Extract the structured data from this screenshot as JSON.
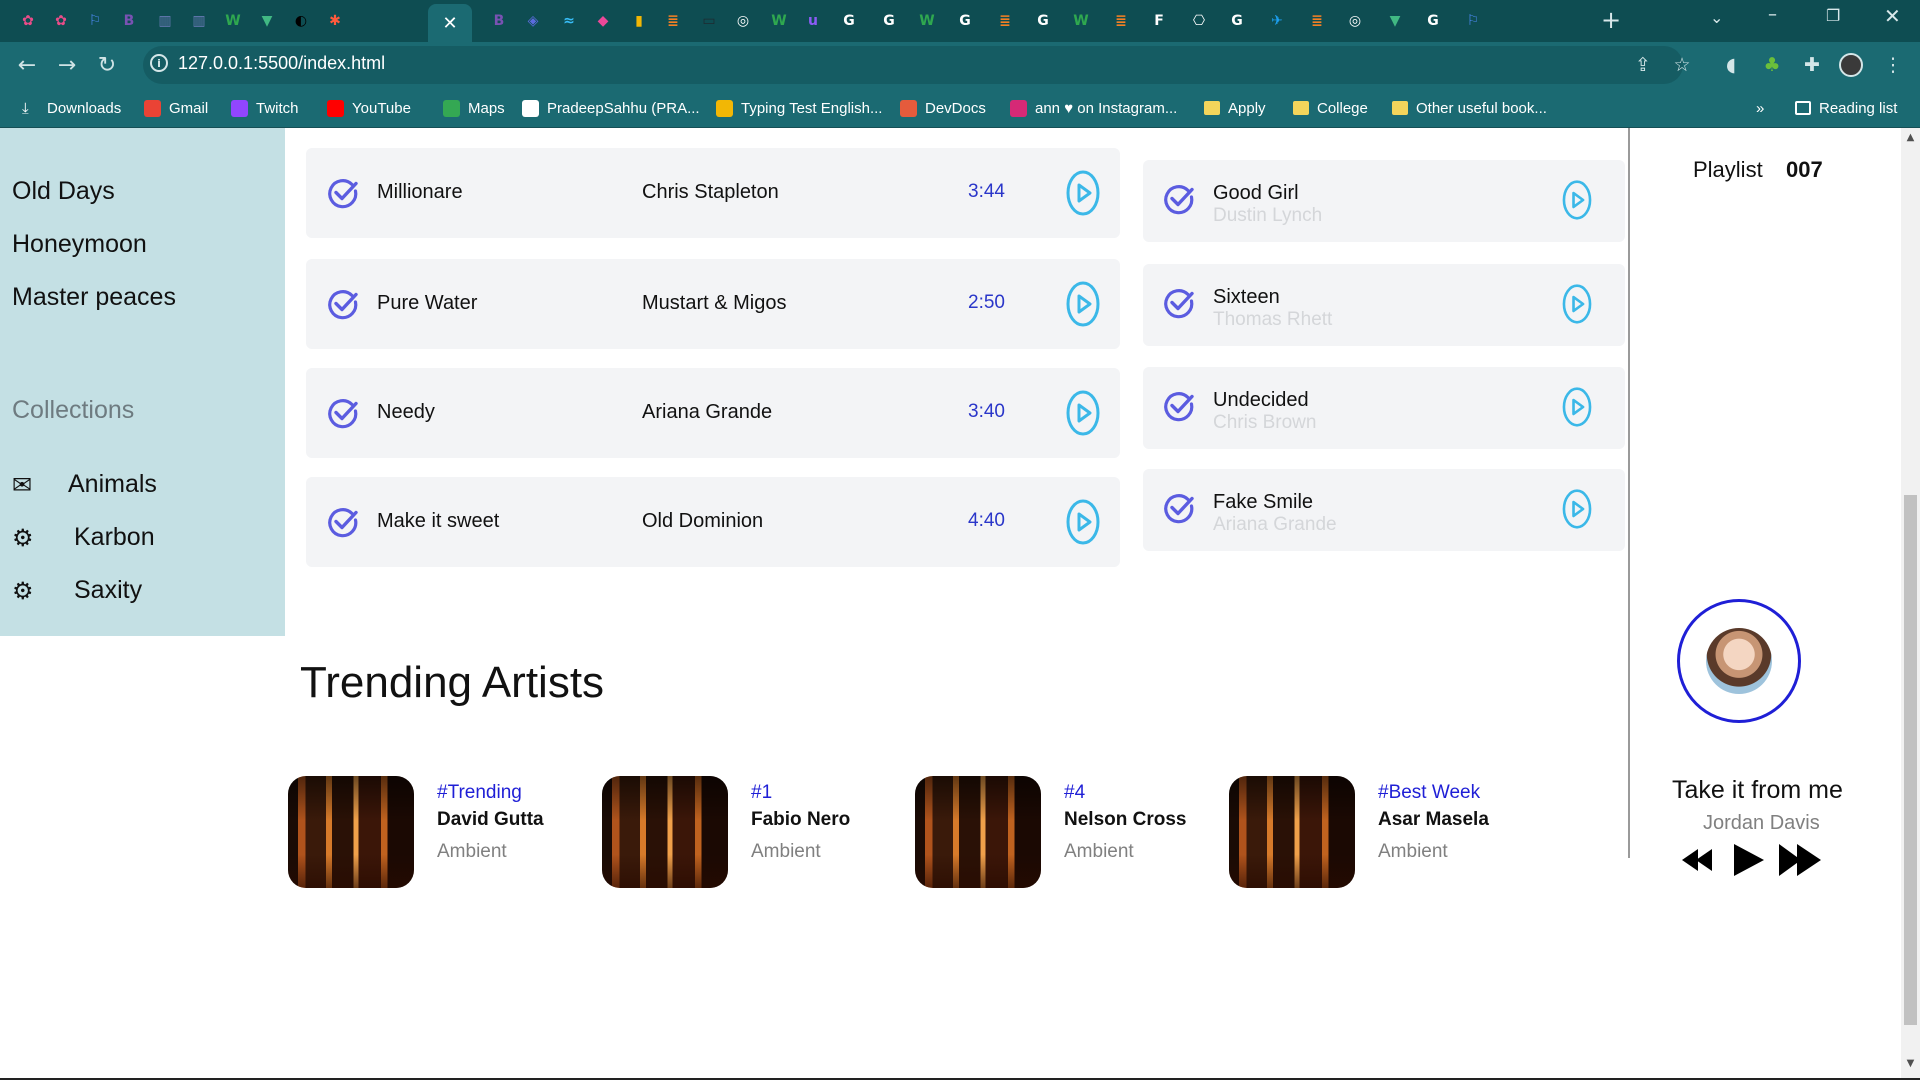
{
  "browser": {
    "tabs": [
      {
        "name": "dribbble-tab-icon",
        "color": "#ea4c89",
        "glyph": "✿"
      },
      {
        "name": "dribbble-tab-icon",
        "color": "#ea4c89",
        "glyph": "✿"
      },
      {
        "name": "flag-tab-icon",
        "color": "#4c8bf5",
        "glyph": "⚐"
      },
      {
        "name": "bootstrap-tab-icon",
        "color": "#7952b3",
        "glyph": "B"
      },
      {
        "name": "uib-tab-icon",
        "color": "#6a7cb8",
        "glyph": "▥"
      },
      {
        "name": "uib-tab-icon",
        "color": "#6a7cb8",
        "glyph": "▥"
      },
      {
        "name": "w-tab-icon",
        "color": "#2fa84f",
        "glyph": "W"
      },
      {
        "name": "vuetify-tab-icon",
        "color": "#41b883",
        "glyph": "▼"
      },
      {
        "name": "chatgpt-tab-icon",
        "color": "#000000",
        "glyph": "◐"
      },
      {
        "name": "asterisk-tab-icon",
        "color": "#ff5a3c",
        "glyph": "✱"
      },
      {
        "name": "close-tab-icon",
        "color": "#ffffff",
        "glyph": "✕"
      },
      {
        "name": "bootstrap-tab-icon",
        "color": "#7952b3",
        "glyph": "B"
      },
      {
        "name": "layers-tab-icon",
        "color": "#5b6bde",
        "glyph": "◈"
      },
      {
        "name": "tailwind-tab-icon",
        "color": "#38bdf8",
        "glyph": "≈"
      },
      {
        "name": "cube-tab-icon",
        "color": "#ec4899",
        "glyph": "◆"
      },
      {
        "name": "shield-tab-icon",
        "color": "#f2b705",
        "glyph": "▮"
      },
      {
        "name": "stack-tab-icon",
        "color": "#f48024",
        "glyph": "≣"
      },
      {
        "name": "monitor-tab-icon",
        "color": "#1e2a30",
        "glyph": "▭"
      },
      {
        "name": "chrome-tab-icon",
        "color": "#ffffff",
        "glyph": "◎"
      },
      {
        "name": "w-tab-icon",
        "color": "#2fa84f",
        "glyph": "W"
      },
      {
        "name": "u-tab-icon",
        "color": "#8b5cf6",
        "glyph": "u"
      },
      {
        "name": "google-tab-icon",
        "color": "#ffffff",
        "glyph": "G"
      },
      {
        "name": "google-tab-icon",
        "color": "#ffffff",
        "glyph": "G"
      },
      {
        "name": "w-tab-icon",
        "color": "#2fa84f",
        "glyph": "W"
      },
      {
        "name": "google-tab-icon",
        "color": "#ffffff",
        "glyph": "G"
      },
      {
        "name": "stack-tab-icon",
        "color": "#f48024",
        "glyph": "≣"
      },
      {
        "name": "google-tab-icon",
        "color": "#ffffff",
        "glyph": "G"
      },
      {
        "name": "w-tab-icon",
        "color": "#2fa84f",
        "glyph": "W"
      },
      {
        "name": "stack-tab-icon",
        "color": "#f48024",
        "glyph": "≣"
      },
      {
        "name": "f-tab-icon",
        "color": "#ffffff",
        "glyph": "F"
      },
      {
        "name": "openai-tab-icon",
        "color": "#ffffff",
        "glyph": "⎔"
      },
      {
        "name": "google-tab-icon",
        "color": "#ffffff",
        "glyph": "G"
      },
      {
        "name": "twitter-tab-icon",
        "color": "#1da1f2",
        "glyph": "✈"
      },
      {
        "name": "stack-tab-icon",
        "color": "#f48024",
        "glyph": "≣"
      },
      {
        "name": "chrome-tab-icon",
        "color": "#ffffff",
        "glyph": "◎"
      },
      {
        "name": "vuetify-tab-icon",
        "color": "#41b883",
        "glyph": "▼"
      },
      {
        "name": "google-tab-icon",
        "color": "#ffffff",
        "glyph": "G"
      },
      {
        "name": "flag-tab-icon",
        "color": "#4c8bf5",
        "glyph": "⚐"
      }
    ],
    "url": "127.0.0.1:5500/index.html",
    "bookmarks": [
      {
        "label": "Downloads",
        "icon": "download-icon",
        "color": "#ffffff"
      },
      {
        "label": "Gmail",
        "icon": "gmail-icon",
        "color": "#ea4335"
      },
      {
        "label": "Twitch",
        "icon": "twitch-icon",
        "color": "#9146ff"
      },
      {
        "label": "YouTube",
        "icon": "youtube-icon",
        "color": "#ff0000"
      },
      {
        "label": "Maps",
        "icon": "maps-icon",
        "color": "#34a853"
      },
      {
        "label": "PradeepSahhu (PRA...",
        "icon": "github-icon",
        "color": "#ffffff"
      },
      {
        "label": "Typing Test English...",
        "icon": "typing-icon",
        "color": "#f2b705"
      },
      {
        "label": "DevDocs",
        "icon": "devdocs-icon",
        "color": "#e55b3c"
      },
      {
        "label": "ann ♥ on Instagram...",
        "icon": "instagram-icon",
        "color": "#d62976"
      },
      {
        "label": "Apply",
        "icon": "folder-icon",
        "color": "#f3d55b"
      },
      {
        "label": "College",
        "icon": "folder-icon",
        "color": "#f3d55b"
      },
      {
        "label": "Other useful book...",
        "icon": "folder-icon",
        "color": "#f3d55b"
      }
    ],
    "overflow": "»",
    "reading_list": "Reading list"
  },
  "sidebar": {
    "items": [
      "Old Days",
      "Honeymoon",
      "Master peaces"
    ],
    "collections_heading": "Collections",
    "collections": [
      {
        "label": "Animals",
        "icon": "envelope-icon"
      },
      {
        "label": "Karbon",
        "icon": "cogs-icon"
      },
      {
        "label": "Saxity",
        "icon": "cogs-icon"
      }
    ]
  },
  "songs": [
    {
      "title": "Millionare",
      "artist": "Chris Stapleton",
      "duration": "3:44"
    },
    {
      "title": "Pure Water",
      "artist": "Mustart & Migos",
      "duration": "2:50"
    },
    {
      "title": "Needy",
      "artist": "Ariana Grande",
      "duration": "3:40"
    },
    {
      "title": "Make it sweet",
      "artist": "Old Dominion",
      "duration": "4:40"
    }
  ],
  "suggestions": [
    {
      "title": "Good Girl",
      "artist": "Dustin Lynch"
    },
    {
      "title": "Sixteen",
      "artist": "Thomas Rhett"
    },
    {
      "title": "Undecided",
      "artist": "Chris Brown"
    },
    {
      "title": "Fake Smile",
      "artist": "Ariana Grande"
    }
  ],
  "trending": {
    "title": "Trending Artists",
    "artists": [
      {
        "tag": "#Trending",
        "name": "David Gutta",
        "genre": "Ambient"
      },
      {
        "tag": "#1",
        "name": "Fabio Nero",
        "genre": "Ambient"
      },
      {
        "tag": "#4",
        "name": "Nelson Cross",
        "genre": "Ambient"
      },
      {
        "tag": "#Best Week",
        "name": "Asar Masela",
        "genre": "Ambient"
      }
    ]
  },
  "player": {
    "playlist_label": "Playlist",
    "playlist_count": "007",
    "now_playing_title": "Take it from me",
    "now_playing_artist": "Jordan Davis"
  },
  "colors": {
    "accent_blue": "#2a36c9",
    "play_cyan": "#3bb8e8",
    "check_purple": "#5b5ce0",
    "sidebar_bg": "#c4e0e4",
    "chrome_bg": "#1b6a72"
  }
}
